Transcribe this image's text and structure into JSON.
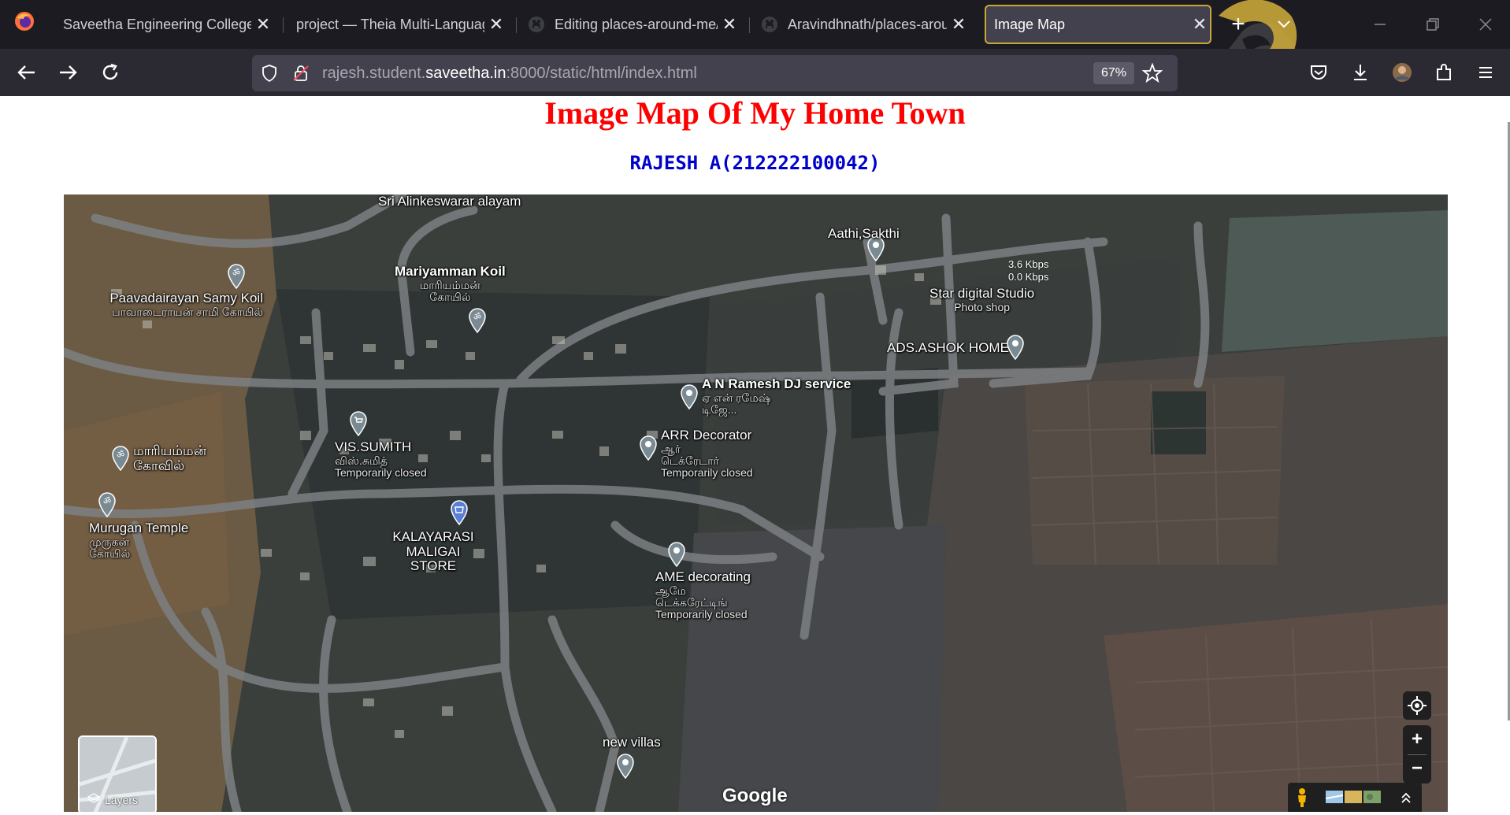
{
  "browser": {
    "tabs": [
      {
        "label": "Saveetha Engineering College",
        "favicon": "none",
        "active": false
      },
      {
        "label": "project — Theia Multi-Language",
        "favicon": "none",
        "active": false
      },
      {
        "label": "Editing places-around-me/I",
        "favicon": "github-icon",
        "active": false
      },
      {
        "label": "Aravindhnath/places-around",
        "favicon": "github-icon",
        "active": false
      },
      {
        "label": "Image Map",
        "favicon": "none",
        "active": true
      }
    ],
    "url": {
      "prefix": "rajesh.student.",
      "host": "saveetha.in",
      "suffix": ":8000/static/html/index.html"
    },
    "zoom_level": "67%"
  },
  "page": {
    "title": "Image Map Of My Home Town",
    "student": "RAJESH A(212222100042)"
  },
  "map": {
    "places": [
      {
        "name": "Sri Alinkeswarar alayam",
        "sub": "",
        "status": ""
      },
      {
        "name": "Aathi,Sakthi",
        "sub": "",
        "status": ""
      },
      {
        "name": "Mariyamman Koil",
        "sub": "மாரியம்மன் கோயில்",
        "status": ""
      },
      {
        "name": "Paavadairayan Samy Koil",
        "sub": "பாவாடைராயன் சாமி கோயில்",
        "status": ""
      },
      {
        "name": "Star digital Studio",
        "sub": "Photo shop",
        "status": ""
      },
      {
        "name": "ADS.ASHOK HOME",
        "sub": "",
        "status": ""
      },
      {
        "name": "A N Ramesh DJ service",
        "sub": "ஏ என் ரமேஷ் டிஜே...",
        "status": ""
      },
      {
        "name": "ARR Decorator",
        "sub": "ஆர் டெக்ரேடார்",
        "status": "Temporarily closed"
      },
      {
        "name": "VIS.SUMITH",
        "sub": "விஸ்.சுமித்",
        "status": "Temporarily closed"
      },
      {
        "name": "மாரியம்மன் கோவில்",
        "sub": "",
        "status": ""
      },
      {
        "name": "Murugan Temple",
        "sub": "முருகன் கோயில்",
        "status": ""
      },
      {
        "name": "KALAYARASI MALIGAI STORE",
        "sub": "",
        "status": ""
      },
      {
        "name": "AME decorating",
        "sub": "ஆமே டெக்கரேட்டிங்",
        "status": "Temporarily closed"
      },
      {
        "name": "new villas",
        "sub": "",
        "status": ""
      }
    ],
    "network_speed": {
      "up": "3.6 Kbps",
      "down": "0.0 Kbps"
    },
    "layers_label": "Layers",
    "zoom_in": "+",
    "zoom_out": "−",
    "google_logo": "Google"
  },
  "colors": {
    "title": "#ff0000",
    "student": "#0000cc",
    "active_tab_border": "#c9a63a",
    "tabbar_bg": "#1c1b22",
    "navbar_bg": "#2b2a33"
  }
}
